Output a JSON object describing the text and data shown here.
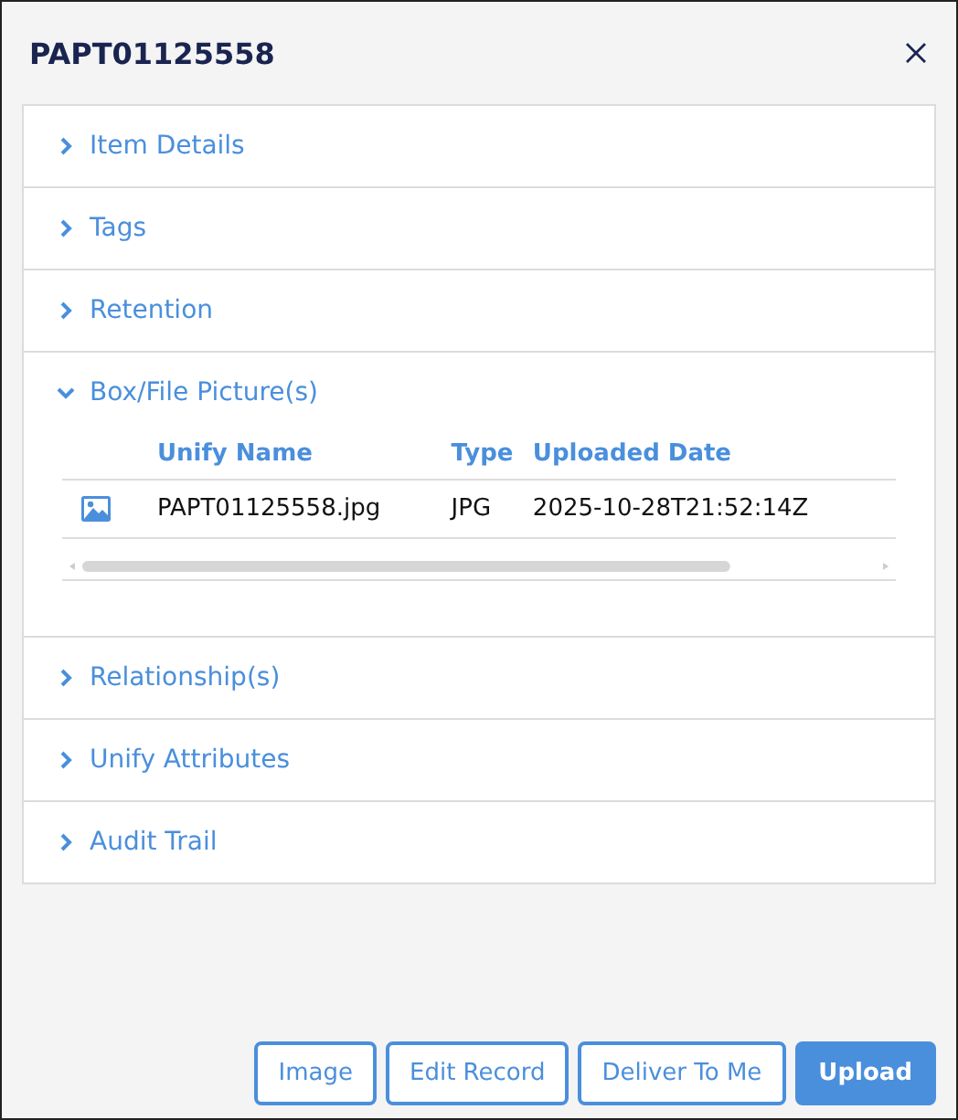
{
  "dialog": {
    "title": "PAPT01125558"
  },
  "sections": [
    {
      "label": "Item Details",
      "expanded": false
    },
    {
      "label": "Tags",
      "expanded": false
    },
    {
      "label": "Retention",
      "expanded": false
    },
    {
      "label": "Box/File Picture(s)",
      "expanded": true,
      "table": {
        "columns": [
          "Unify Name",
          "Type",
          "Uploaded Date"
        ],
        "rows": [
          [
            "PAPT01125558.jpg",
            "JPG",
            "2025-10-28T21:52:14Z"
          ]
        ]
      }
    },
    {
      "label": "Relationship(s)",
      "expanded": false
    },
    {
      "label": "Unify Attributes",
      "expanded": false
    },
    {
      "label": "Audit Trail",
      "expanded": false
    }
  ],
  "buttons": [
    {
      "label": "Image",
      "kind": "outline"
    },
    {
      "label": "Edit Record",
      "kind": "outline"
    },
    {
      "label": "Deliver To Me",
      "kind": "outline"
    },
    {
      "label": "Upload",
      "kind": "primary"
    }
  ]
}
